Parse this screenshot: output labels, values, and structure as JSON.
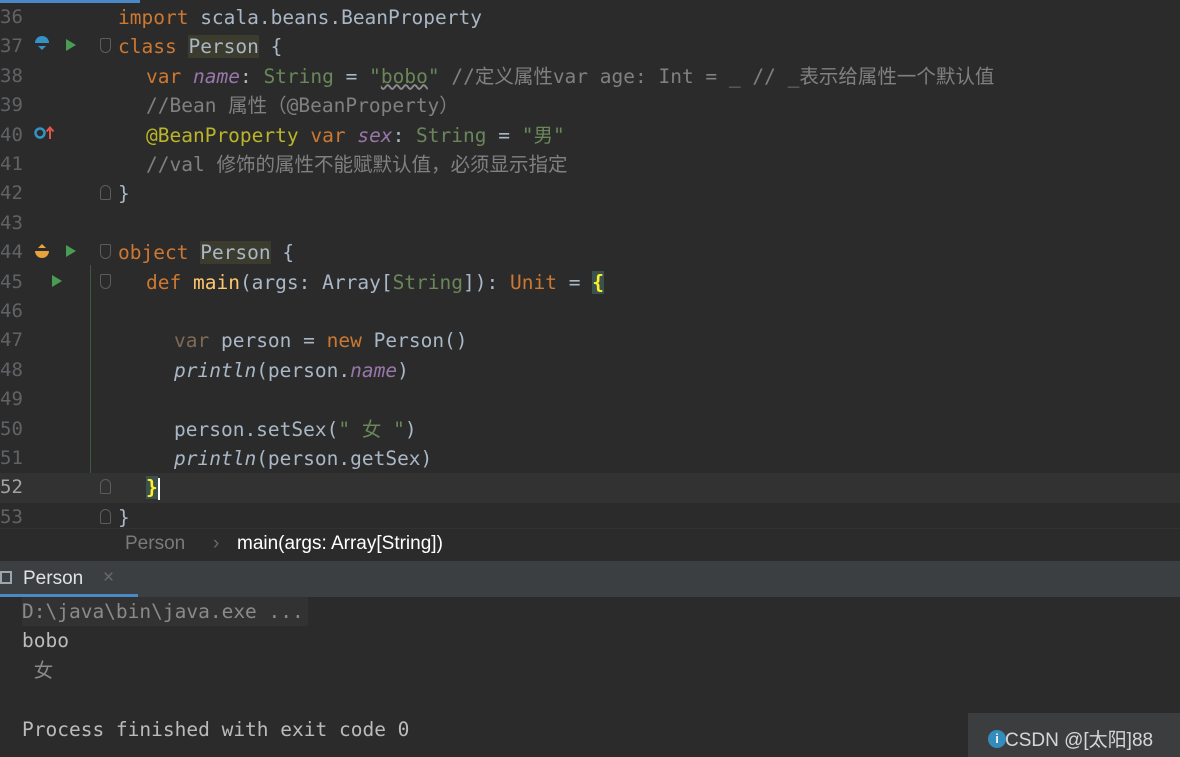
{
  "editor": {
    "lines": [
      {
        "num": "36"
      },
      {
        "num": "37"
      },
      {
        "num": "38"
      },
      {
        "num": "39"
      },
      {
        "num": "40"
      },
      {
        "num": "41"
      },
      {
        "num": "42"
      },
      {
        "num": "43"
      },
      {
        "num": "44"
      },
      {
        "num": "45"
      },
      {
        "num": "46"
      },
      {
        "num": "47"
      },
      {
        "num": "48"
      },
      {
        "num": "49"
      },
      {
        "num": "50"
      },
      {
        "num": "51"
      },
      {
        "num": "52"
      },
      {
        "num": "53"
      }
    ],
    "code": {
      "l36": {
        "kw": "import",
        "rest": " scala.beans.BeanProperty"
      },
      "l37": {
        "kw": "class",
        "name": "Person",
        "rest": " {"
      },
      "l38": {
        "kw": "var",
        "field": "name",
        "colon": ": ",
        "type": "String",
        "eq": " = ",
        "q1": "\"",
        "str": "bobo",
        "q2": "\"",
        "comment": " //定义属性var age: Int = _ // _表示给属性一个默认值"
      },
      "l39": {
        "comment": "//Bean 属性（@BeanProperty）"
      },
      "l40": {
        "anno": "@BeanProperty",
        "kw": " var ",
        "field": "sex",
        "colon": ": ",
        "type": "String",
        "eq": " = ",
        "str": "\"男\""
      },
      "l41": {
        "comment": "//val 修饰的属性不能赋默认值，必须显示指定"
      },
      "l42": {
        "text": "}"
      },
      "l44": {
        "kw": "object",
        "name": "Person",
        "rest": " {"
      },
      "l45": {
        "kw": "def",
        "fn": " main",
        "p1": "(args: Array[",
        "type": "String",
        "p2": "]): ",
        "unit": "Unit",
        "eq": " = ",
        "brace": "{"
      },
      "l47": {
        "kw": "var",
        "rest1": " person = ",
        "kw2": "new",
        "rest2": " Person()"
      },
      "l48": {
        "fn": "println",
        "p1": "(person.",
        "field": "name",
        "p2": ")"
      },
      "l50": {
        "p1": "person.setSex(",
        "str": "\" 女 \"",
        "p2": ")"
      },
      "l51": {
        "fn": "println",
        "p1": "(person.getSex)"
      },
      "l52": {
        "brace": "}"
      },
      "l53": {
        "text": "}"
      }
    }
  },
  "breadcrumb": {
    "item1": "Person",
    "sep": "›",
    "item2": "main(args: Array[String])"
  },
  "run_panel": {
    "tab_label": "Person",
    "tab_close": "×"
  },
  "console": {
    "line1": "D:\\java\\bin\\java.exe ...",
    "line2": "bobo",
    "line3": " 女",
    "line4": "Process finished with exit code 0"
  },
  "watermark": {
    "icon": "i",
    "text": "CSDN @[太阳]88"
  },
  "colors": {
    "background": "#2b2b2b",
    "keyword": "#cc7832",
    "string": "#6a8759",
    "comment": "#808080",
    "field": "#9876aa",
    "annotation": "#bbb529",
    "accent": "#4a88c7"
  }
}
